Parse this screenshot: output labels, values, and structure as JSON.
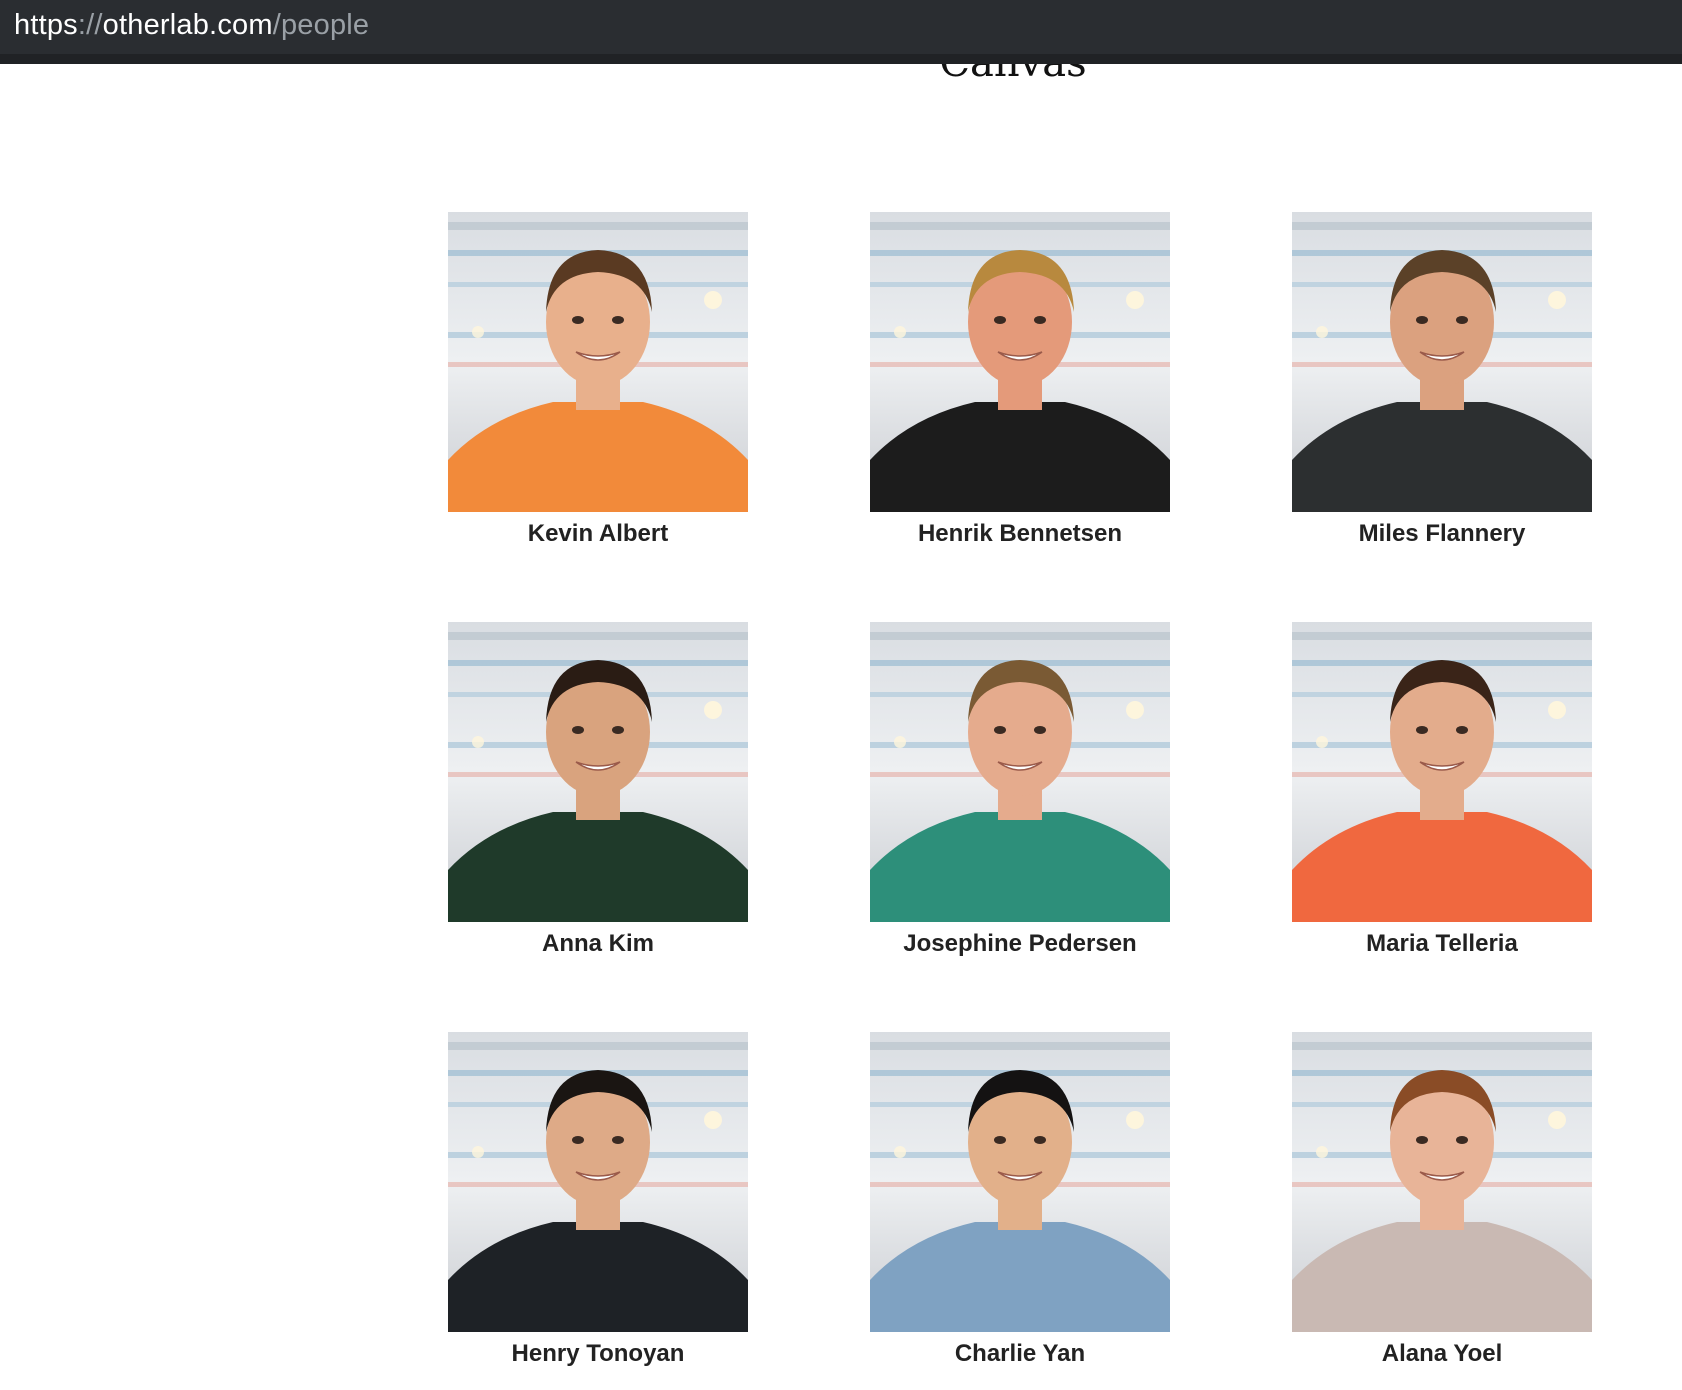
{
  "browser": {
    "url_scheme": "https",
    "url_sep": "://",
    "url_host": "otherlab.com",
    "url_path": "/people"
  },
  "section": {
    "title": "Canvas"
  },
  "people": [
    {
      "name": "Kevin Albert",
      "shirt": "#f28a3a",
      "hair": "#5a3a22",
      "skin": "#e8b08c"
    },
    {
      "name": "Henrik Bennetsen",
      "shirt": "#1c1c1c",
      "hair": "#b8893e",
      "skin": "#e49a7a"
    },
    {
      "name": "Miles Flannery",
      "shirt": "#2c2f30",
      "hair": "#5b4128",
      "skin": "#dba17f"
    },
    {
      "name": "Anna Kim",
      "shirt": "#1f3a2a",
      "hair": "#2a1c14",
      "skin": "#d9a37e"
    },
    {
      "name": "Josephine Pedersen",
      "shirt": "#2d8f7a",
      "hair": "#7a5a34",
      "skin": "#e5ab8d"
    },
    {
      "name": "Maria Telleria",
      "shirt": "#f0683f",
      "hair": "#3a2418",
      "skin": "#e3ac8c"
    },
    {
      "name": "Henry Tonoyan",
      "shirt": "#1e2226",
      "hair": "#1a1512",
      "skin": "#deaa87"
    },
    {
      "name": "Charlie Yan",
      "shirt": "#7fa2c2",
      "hair": "#141212",
      "skin": "#e2b08a"
    },
    {
      "name": "Alana Yoel",
      "shirt": "#c9b9b3",
      "hair": "#8a4c26",
      "skin": "#e8b498"
    }
  ]
}
